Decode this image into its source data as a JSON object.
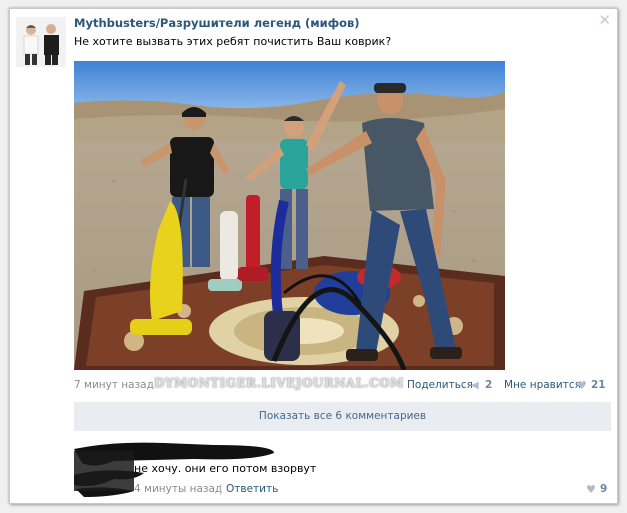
{
  "post": {
    "group_name": "Mythbusters/Разрушители легенд (мифов)",
    "text": "Не хотите вызвать этих ребят почистить Ваш коврик?",
    "close_icon": "close-icon",
    "photo_description_icon": "photo"
  },
  "footer": {
    "time": "7 минут назад",
    "share_label": "Поделиться",
    "share_count": "2",
    "like_label": "Мне нравится",
    "like_count": "21",
    "watermark": "DYMONTIGER.LIVEJOURNAL.COM"
  },
  "comments": {
    "show_all_label": "Показать все 6 комментариев",
    "items": [
      {
        "text": "не хочу. они его потом взорвут",
        "time": "4 минуты назад",
        "separator": "|",
        "reply_label": "Ответить",
        "like_count": "9"
      }
    ]
  },
  "colors": {
    "link": "#2b587a",
    "muted": "#8c8c8c",
    "button_bg": "#e9edf1",
    "button_text": "#45688e"
  }
}
